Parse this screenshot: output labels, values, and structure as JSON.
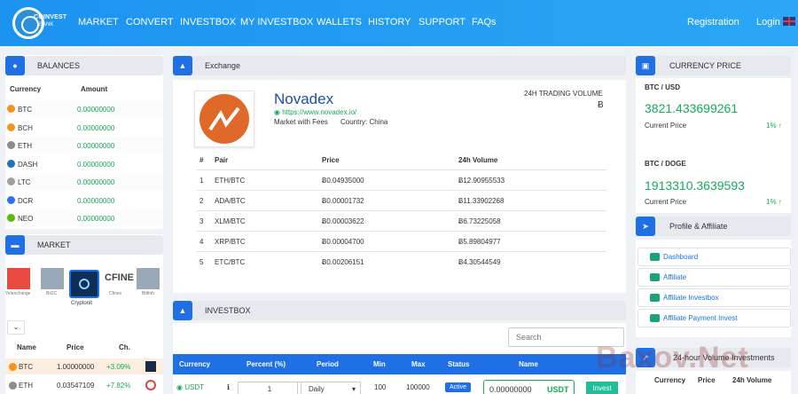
{
  "nav": {
    "logo_line1": "COINVEST",
    "logo_line2": "BANK",
    "items": [
      "MARKET",
      "CONVERT",
      "INVESTBOX",
      "MY INVESTBOX",
      "WALLETS",
      "HISTORY",
      "SUPPORT",
      "FAQs"
    ],
    "registration": "Registration",
    "login": "Login"
  },
  "balances": {
    "title": "BALANCES",
    "col_currency": "Currency",
    "col_amount": "Amount",
    "rows": [
      {
        "name": "BTC",
        "amount": "0.00000000",
        "color": "#f7931a"
      },
      {
        "name": "BCH",
        "amount": "0.00000000",
        "color": "#f7931a"
      },
      {
        "name": "ETH",
        "amount": "0.00000000",
        "color": "#8c8c8c"
      },
      {
        "name": "DASH",
        "amount": "0.00000000",
        "color": "#1c75bc"
      },
      {
        "name": "LTC",
        "amount": "0.00000000",
        "color": "#a0a0a0"
      },
      {
        "name": "DCR",
        "amount": "0.00000000",
        "color": "#2970ff"
      },
      {
        "name": "NEO",
        "amount": "0.00000000",
        "color": "#58bf00"
      }
    ]
  },
  "market": {
    "title": "MARKET",
    "exchanges": [
      "Yelexchange",
      "Bit2C",
      "Cryptonit",
      "Cfinex",
      "Bitfinh"
    ],
    "cfinex_logo": "CFINE",
    "col_name": "Name",
    "col_price": "Price",
    "col_change": "Ch.",
    "rows": [
      {
        "name": "BTC",
        "price": "1.00000000",
        "change": "+3.09%"
      },
      {
        "name": "ETH",
        "price": "0.03547109",
        "change": "+7.82%"
      }
    ]
  },
  "exchange": {
    "title": "Exchange",
    "name": "Novadex",
    "url": "https://www.novadex.io/",
    "fees": "Market with Fees",
    "country": "Country: China",
    "volume_label": "24H TRADING VOLUME",
    "volume_symbol": "Ƀ",
    "columns": [
      "#",
      "Pair",
      "Price",
      "24h Volume"
    ],
    "rows": [
      {
        "n": "1",
        "pair": "ETH/BTC",
        "price": "Ƀ0.04935000",
        "volume": "Ƀ12.90955533"
      },
      {
        "n": "2",
        "pair": "ADA/BTC",
        "price": "Ƀ0.00001732",
        "volume": "Ƀ11.33902268"
      },
      {
        "n": "3",
        "pair": "XLM/BTC",
        "price": "Ƀ0.00003622",
        "volume": "Ƀ6.73225058"
      },
      {
        "n": "4",
        "pair": "XRP/BTC",
        "price": "Ƀ0.00004700",
        "volume": "Ƀ5.89804977"
      },
      {
        "n": "5",
        "pair": "ETC/BTC",
        "price": "Ƀ0.00206151",
        "volume": "Ƀ4.30544549"
      }
    ]
  },
  "investbox": {
    "title": "INVESTBOX",
    "search_placeholder": "Search",
    "columns": [
      "Currency",
      "Percent (%)",
      "Period",
      "Min",
      "Max",
      "Status",
      "Name"
    ],
    "row": {
      "currency": "USDT",
      "percent": "1",
      "period": "Daily",
      "min": "100",
      "max": "100000",
      "status": "Active",
      "amount": "0.00000000",
      "unit": "USDT",
      "invest": "Invest"
    }
  },
  "currency_price": {
    "title": "CURRENCY PRICE",
    "pairs": [
      {
        "pair": "BTC / USD",
        "value": "3821.433699261",
        "label": "Current Price",
        "change": "1%"
      },
      {
        "pair": "BTC / DOGE",
        "value": "1913310.3639593",
        "label": "Current Price",
        "change": "1%"
      }
    ]
  },
  "profile": {
    "title": "Profile & Affiliate",
    "links": [
      "Dashboard",
      "Affiliate",
      "Affiliate Investbox",
      "Affiliate Payment Invest"
    ]
  },
  "volume_investments": {
    "title": "24-hour Volume Investments",
    "columns": [
      "Currency",
      "Price",
      "24h Volume"
    ]
  },
  "watermark": "Baxov.Net",
  "colors": {
    "primary": "#1f6fe5",
    "nav": "#1b93f0",
    "green": "#17a85a"
  }
}
